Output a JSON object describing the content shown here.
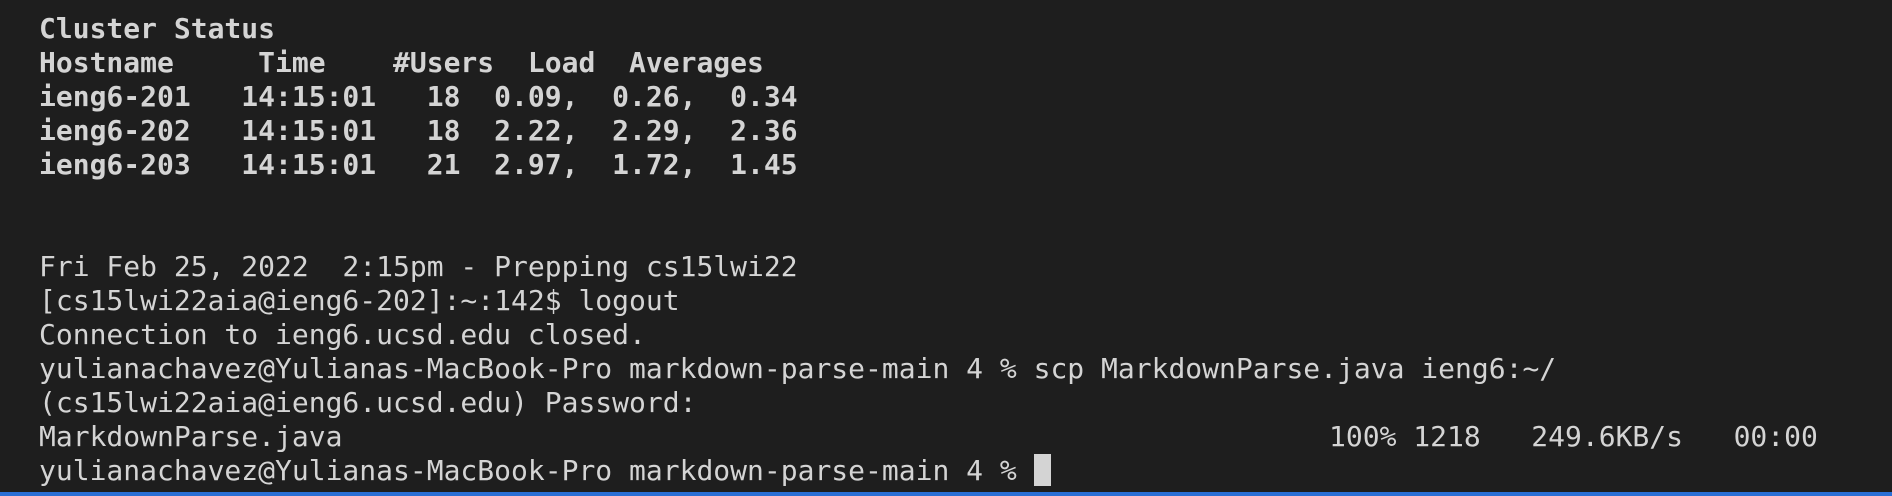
{
  "cluster": {
    "title": "Cluster Status",
    "header": "Hostname     Time    #Users  Load  Averages",
    "rows": [
      "ieng6-201   14:15:01   18  0.09,  0.26,  0.34",
      "ieng6-202   14:15:01   18  2.22,  2.29,  2.36",
      "ieng6-203   14:15:01   21  2.97,  1.72,  1.45"
    ]
  },
  "output": {
    "motd": "Fri Feb 25, 2022  2:15pm - Prepping cs15lwi22",
    "logout_cmd": "[cs15lwi22aia@ieng6-202]:~:142$ logout",
    "closed": "Connection to ieng6.ucsd.edu closed.",
    "scp_cmd": "yulianachavez@Yulianas-MacBook-Pro markdown-parse-main 4 % scp MarkdownParse.java ieng6:~/",
    "password_prompt": "(cs15lwi22aia@ieng6.ucsd.edu) Password:",
    "transfer_file": "MarkdownParse.java",
    "transfer_stats": "100% 1218   249.6KB/s   00:00",
    "current_prompt": "yulianachavez@Yulianas-MacBook-Pro markdown-parse-main 4 % "
  },
  "colors": {
    "background": "#1e1e1e",
    "text": "#d4d4d4",
    "accent_border": "#2a6fd6"
  }
}
